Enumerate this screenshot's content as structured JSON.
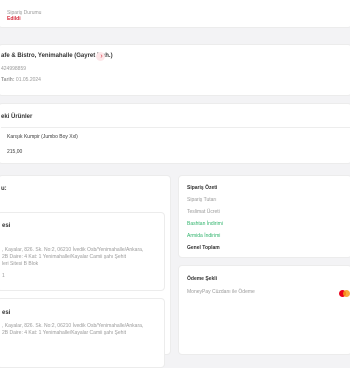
{
  "order_status": {
    "label": "Sipariş Durumu",
    "value": "Edildi"
  },
  "restaurant": {
    "name": "afe & Bistro, Yenimahalle (Gayret Mah.)",
    "order_no": "424998859",
    "date_label": "Tarih:",
    "date": "01.05.2024"
  },
  "products": {
    "title": "eki Ürünler",
    "items": [
      {
        "name": "Karışık Kumpir (Jumbo Boy Xxl)",
        "price": "215,00"
      }
    ]
  },
  "delivery": {
    "section_label": "u:",
    "address_card": {
      "title": "esi",
      "lines": [
        ", Kayalar, 826. Sk. No:2, 06210 İvedik Osb/Yenimahalle/Ankara,",
        "2B Daire: 4 Kat: 1 Yenimahalle/Kayalar Camii şahı Şehit",
        "leri Sitesi B Blok"
      ],
      "extra": "1"
    },
    "invoice_card": {
      "title": "esi",
      "lines": [
        ", Kayalar, 826. Sk. No:2, 06210 İvedik Osb/Yenimahalle/Ankara,",
        "2B Daire: 4 Kat: 1 Yenimahalle/Kayalar Camii şahı Şehit"
      ]
    }
  },
  "summary": {
    "title": "Sipariş Özeti",
    "rows": [
      {
        "label": "Sipariş Tutarı",
        "tone": "muted"
      },
      {
        "label": "Teslimat Ücreti",
        "tone": "muted"
      },
      {
        "label": "Bashtan İndirimi",
        "tone": "green"
      },
      {
        "label": "Armida İndirimi",
        "tone": "green"
      }
    ],
    "total_label": "Genel Toplam"
  },
  "payment": {
    "title": "Ödeme Şekli",
    "method": "MoneyPay Cüzdanı ile Ödeme",
    "colors": {
      "red": "#eb001b",
      "orange": "#f79e1b"
    }
  }
}
